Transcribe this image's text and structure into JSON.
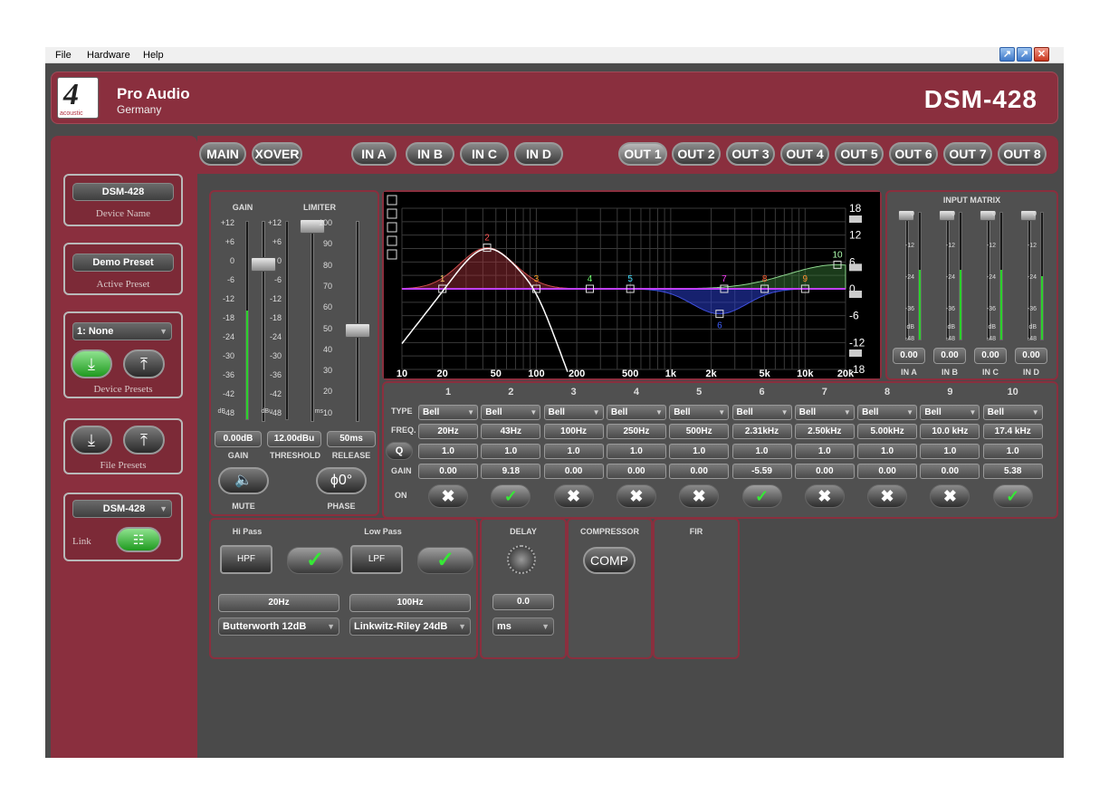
{
  "menu": {
    "file": "File",
    "hardware": "Hardware",
    "help": "Help"
  },
  "header": {
    "logo_number": "4",
    "logo_word": "acoustic",
    "brand": "Pro Audio",
    "brand_sub": "Germany",
    "model": "DSM-428"
  },
  "sidebar": {
    "device_name_value": "DSM-428",
    "device_name_label": "Device Name",
    "active_preset_value": "Demo Preset",
    "active_preset_label": "Active Preset",
    "device_preset_select": "1: None",
    "device_presets_label": "Device Presets",
    "file_presets_label": "File Presets",
    "link_select": "DSM-428",
    "link_label": "Link"
  },
  "tabs": [
    "MAIN",
    "XOVER",
    "IN A",
    "IN B",
    "IN C",
    "IN D",
    "OUT 1",
    "OUT 2",
    "OUT 3",
    "OUT 4",
    "OUT 5",
    "OUT 6",
    "OUT 7",
    "OUT 8"
  ],
  "active_tab": "OUT 1",
  "gain_panel": {
    "gain_title": "GAIN",
    "limiter_title": "LIMITER",
    "gain_scale": [
      "+12",
      "+6",
      "0",
      "-6",
      "-12",
      "-18",
      "-24",
      "-30",
      "-36",
      "-42",
      "-48"
    ],
    "limiter_scale": [
      "+12",
      "+6",
      "0",
      "-6",
      "-12",
      "-18",
      "-24",
      "-30",
      "-36",
      "-42",
      "-48"
    ],
    "release_scale": [
      "100",
      "90",
      "80",
      "70",
      "60",
      "50",
      "40",
      "30",
      "20",
      "10"
    ],
    "gain_unit": "dB",
    "limiter_unit": "dBu",
    "release_unit": "ms",
    "gain_value": "0.00dB",
    "threshold_value": "12.00dBu",
    "release_value": "50ms",
    "gain_label": "GAIN",
    "threshold_label": "THRESHOLD",
    "release_label": "RELEASE",
    "mute_label": "MUTE",
    "phase_label": "PHASE",
    "phase_button": "ϕ0°"
  },
  "eq_graph": {
    "x_ticks": [
      "10",
      "20",
      "50",
      "100",
      "200",
      "500",
      "1k",
      "2k",
      "5k",
      "10k",
      "20k"
    ],
    "y_ticks": [
      "18",
      "12",
      "6",
      "0",
      "-6",
      "-12",
      "-18"
    ],
    "point_labels": [
      "1",
      "2",
      "3",
      "4",
      "5",
      "6",
      "7",
      "8",
      "9",
      "10"
    ]
  },
  "eq_table": {
    "row_labels": {
      "type": "TYPE",
      "freq": "FREQ.",
      "q": "Q",
      "gain": "GAIN",
      "on": "ON"
    },
    "bands": [
      {
        "n": "1",
        "type": "Bell",
        "freq": "20Hz",
        "q": "1.0",
        "gain": "0.00",
        "on": false
      },
      {
        "n": "2",
        "type": "Bell",
        "freq": "43Hz",
        "q": "1.0",
        "gain": "9.18",
        "on": true
      },
      {
        "n": "3",
        "type": "Bell",
        "freq": "100Hz",
        "q": "1.0",
        "gain": "0.00",
        "on": false
      },
      {
        "n": "4",
        "type": "Bell",
        "freq": "250Hz",
        "q": "1.0",
        "gain": "0.00",
        "on": false
      },
      {
        "n": "5",
        "type": "Bell",
        "freq": "500Hz",
        "q": "1.0",
        "gain": "0.00",
        "on": false
      },
      {
        "n": "6",
        "type": "Bell",
        "freq": "2.31kHz",
        "q": "1.0",
        "gain": "-5.59",
        "on": true
      },
      {
        "n": "7",
        "type": "Bell",
        "freq": "2.50kHz",
        "q": "1.0",
        "gain": "0.00",
        "on": false
      },
      {
        "n": "8",
        "type": "Bell",
        "freq": "5.00kHz",
        "q": "1.0",
        "gain": "0.00",
        "on": false
      },
      {
        "n": "9",
        "type": "Bell",
        "freq": "10.0 kHz",
        "q": "1.0",
        "gain": "0.00",
        "on": false
      },
      {
        "n": "10",
        "type": "Bell",
        "freq": "17.4 kHz",
        "q": "1.0",
        "gain": "5.38",
        "on": true
      }
    ]
  },
  "input_matrix": {
    "title": "INPUT MATRIX",
    "scale": [
      "0",
      "-12",
      "-24",
      "-36",
      "dB",
      "-48"
    ],
    "values": [
      "0.00",
      "0.00",
      "0.00",
      "0.00"
    ],
    "labels": [
      "IN A",
      "IN B",
      "IN C",
      "IN D"
    ]
  },
  "xover": {
    "hipass_title": "Hi Pass",
    "lowpass_title": "Low Pass",
    "hpf_button": "HPF",
    "lpf_button": "LPF",
    "hipass_freq": "20Hz",
    "lowpass_freq": "100Hz",
    "hipass_type": "Butterworth 12dB",
    "lowpass_type": "Linkwitz-Riley 24dB"
  },
  "delay": {
    "title": "DELAY",
    "value": "0.0",
    "unit": "ms"
  },
  "compressor": {
    "title": "COMPRESSOR",
    "button": "COMP"
  },
  "fir": {
    "title": "FIR"
  },
  "colors": {
    "accent": "#8a2f3e",
    "panel": "#505050",
    "on_green": "#36e836"
  }
}
